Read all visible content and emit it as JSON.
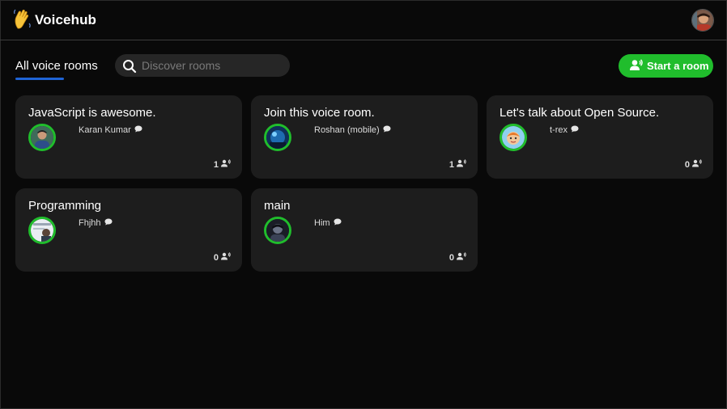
{
  "app": {
    "title": "Voicehub",
    "logo_icon": "waving-hand-icon"
  },
  "header": {
    "profile_avatar": "user-avatar"
  },
  "toolbar": {
    "tab_label": "All voice rooms",
    "search_placeholder": "Discover rooms",
    "search_value": "",
    "start_button_label": "Start a room"
  },
  "colors": {
    "accent": "#20bd2c",
    "tab_underline": "#1f64d6",
    "card_bg": "#1d1d1d",
    "page_bg": "#090909"
  },
  "rooms": [
    {
      "title": "JavaScript is awesome.",
      "speaker": "Karan Kumar",
      "count": "1"
    },
    {
      "title": "Join this voice room.",
      "speaker": "Roshan (mobile)",
      "count": "1"
    },
    {
      "title": "Let's talk about Open Source.",
      "speaker": "t-rex",
      "count": "0"
    },
    {
      "title": "Programming",
      "speaker": "Fhjhh",
      "count": "0"
    },
    {
      "title": "main",
      "speaker": "Him",
      "count": "0"
    }
  ]
}
